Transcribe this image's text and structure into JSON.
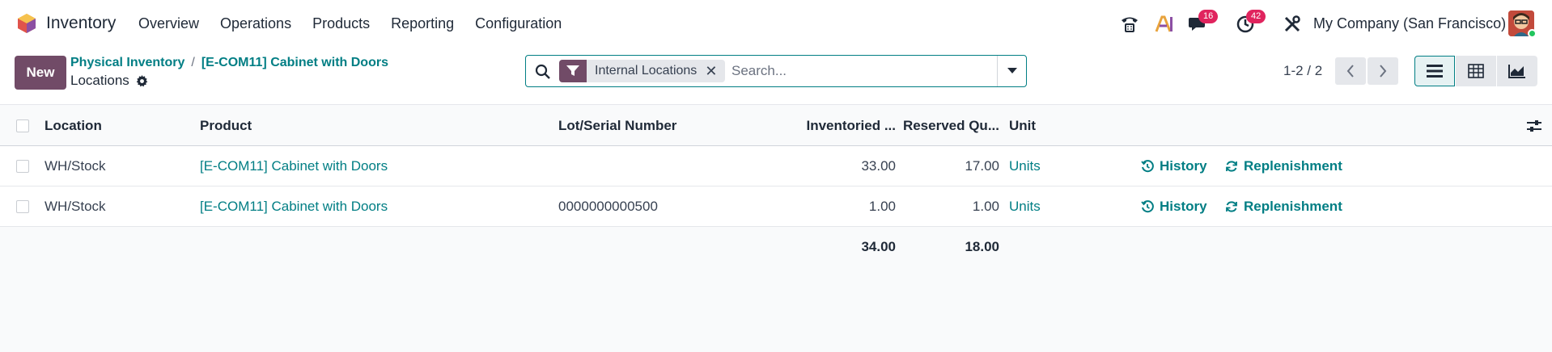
{
  "navbar": {
    "app_name": "Inventory",
    "menu": [
      "Overview",
      "Operations",
      "Products",
      "Reporting",
      "Configuration"
    ],
    "discuss_badge": "16",
    "activity_badge": "42",
    "company": "My Company (San Francisco)"
  },
  "control": {
    "new_label": "New",
    "breadcrumb": [
      "Physical Inventory",
      "[E-COM11] Cabinet with Doors"
    ],
    "breadcrumb_sep": "/",
    "title": "Locations",
    "search": {
      "facet": "Internal Locations",
      "facet_remove": "✕",
      "placeholder": "Search..."
    },
    "pager": "1-2 / 2"
  },
  "table": {
    "columns": {
      "location": "Location",
      "product": "Product",
      "lot": "Lot/Serial Number",
      "inventoried": "Inventoried ...",
      "reserved": "Reserved Qu...",
      "unit": "Unit"
    },
    "rows": [
      {
        "location": "WH/Stock",
        "product": "[E-COM11] Cabinet with Doors",
        "lot": "",
        "inventoried": "33.00",
        "reserved": "17.00",
        "unit": "Units",
        "history": "History",
        "replenishment": "Replenishment"
      },
      {
        "location": "WH/Stock",
        "product": "[E-COM11] Cabinet with Doors",
        "lot": "0000000000500",
        "inventoried": "1.00",
        "reserved": "1.00",
        "unit": "Units",
        "history": "History",
        "replenishment": "Replenishment"
      }
    ],
    "totals": {
      "inventoried": "34.00",
      "reserved": "18.00"
    }
  },
  "colors": {
    "brand": "#714b67",
    "link": "#017e84",
    "badge": "#e0245e"
  }
}
